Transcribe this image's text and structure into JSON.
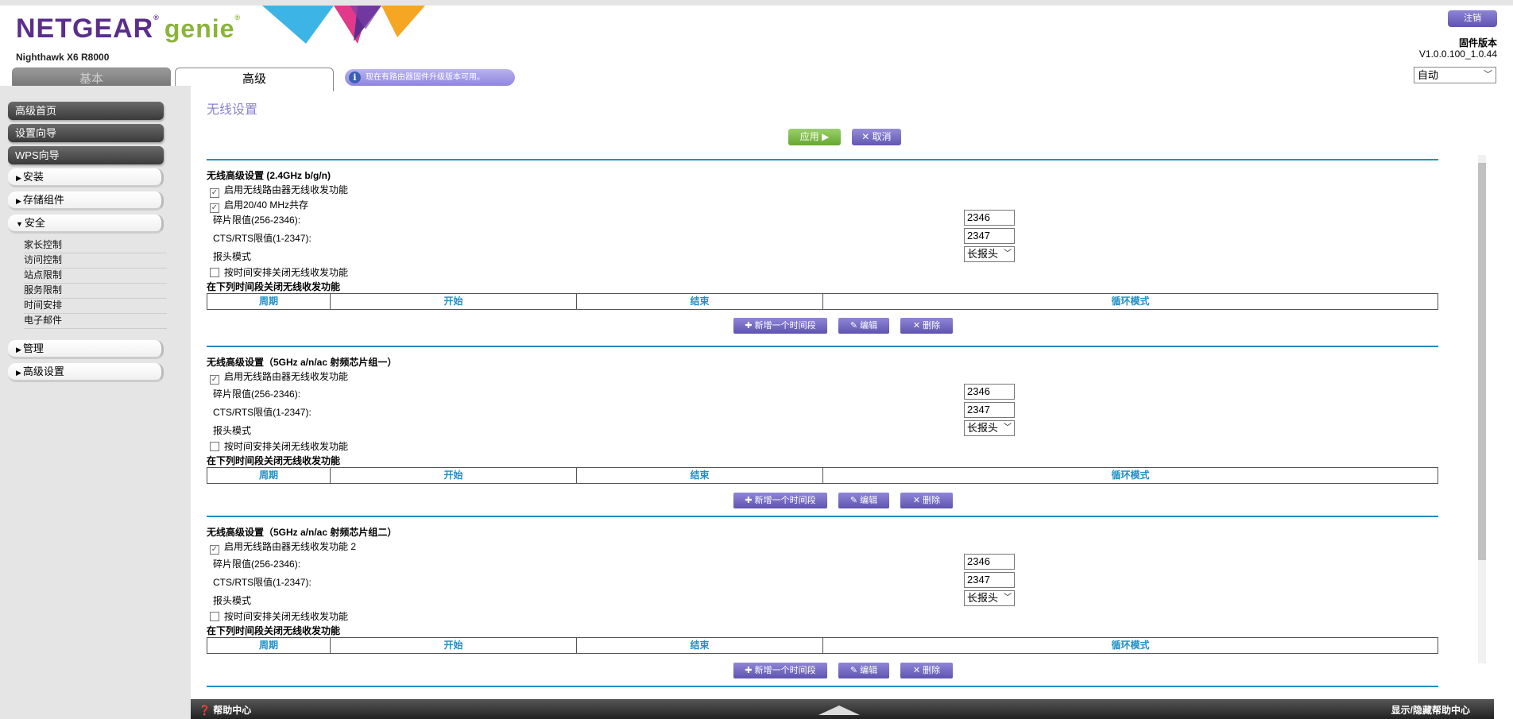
{
  "header": {
    "logo_brand": "NETGEAR",
    "logo_product": "genie",
    "model": "Nighthawk X6 R8000",
    "tabs": [
      {
        "label": "基本"
      },
      {
        "label": "高级"
      }
    ],
    "notice": "现在有路由器固件升级版本可用。",
    "logout": "注销",
    "firmware_title": "固件版本",
    "firmware_version": "V1.0.0.100_1.0.44",
    "language": "自动"
  },
  "sidebar": {
    "buttons": [
      {
        "label": "高级首页"
      },
      {
        "label": "设置向导"
      },
      {
        "label": "WPS向导"
      }
    ],
    "groups": [
      {
        "label": "安装",
        "arrow": "▶"
      },
      {
        "label": "存储组件",
        "arrow": "▶"
      },
      {
        "label": "安全",
        "arrow": "▼"
      },
      {
        "label": "管理",
        "arrow": "▶"
      },
      {
        "label": "高级设置",
        "arrow": "▶"
      }
    ],
    "security_items": [
      {
        "label": "家长控制"
      },
      {
        "label": "访问控制"
      },
      {
        "label": "站点限制"
      },
      {
        "label": "服务限制"
      },
      {
        "label": "时间安排"
      },
      {
        "label": "电子邮件"
      }
    ]
  },
  "main": {
    "title": "无线设置",
    "apply": "应用 ▶",
    "cancel": "✕ 取消",
    "sections": [
      {
        "title": "无线高级设置 (2.4GHz b/g/n)",
        "enable": "启用无线路由器无线收发功能",
        "coexist": "启用20/40 MHz共存",
        "frag_label": "碎片限值(256-2346):",
        "frag_value": "2346",
        "rts_label": "CTS/RTS限值(1-2347):",
        "rts_value": "2347",
        "preamble_label": "报头模式",
        "preamble_value": "长报头",
        "schedule_chk": "按时间安排关闭无线收发功能",
        "schedule_title": "在下列时间段关闭无线收发功能"
      },
      {
        "title": "无线高级设置（5GHz a/n/ac 射频芯片组一）",
        "enable": "启用无线路由器无线收发功能",
        "frag_label": "碎片限值(256-2346):",
        "frag_value": "2346",
        "rts_label": "CTS/RTS限值(1-2347):",
        "rts_value": "2347",
        "preamble_label": "报头模式",
        "preamble_value": "长报头",
        "schedule_chk": "按时间安排关闭无线收发功能",
        "schedule_title": "在下列时间段关闭无线收发功能"
      },
      {
        "title": "无线高级设置（5GHz a/n/ac 射频芯片组二）",
        "enable": "启用无线路由器无线收发功能 2",
        "frag_label": "碎片限值(256-2346):",
        "frag_value": "2346",
        "rts_label": "CTS/RTS限值(1-2347):",
        "rts_value": "2347",
        "preamble_label": "报头模式",
        "preamble_value": "长报头",
        "schedule_chk": "按时间安排关闭无线收发功能",
        "schedule_title": "在下列时间段关闭无线收发功能"
      }
    ],
    "table_headers": [
      "周期",
      "开始",
      "结束",
      "循环模式"
    ],
    "sched_buttons": {
      "add": "✚ 新增一个时间段",
      "edit": "✎ 编辑",
      "delete": "✕ 删除"
    }
  },
  "footer": {
    "help": "❓ 帮助中心",
    "toggle": "显示/隐藏帮助中心"
  }
}
